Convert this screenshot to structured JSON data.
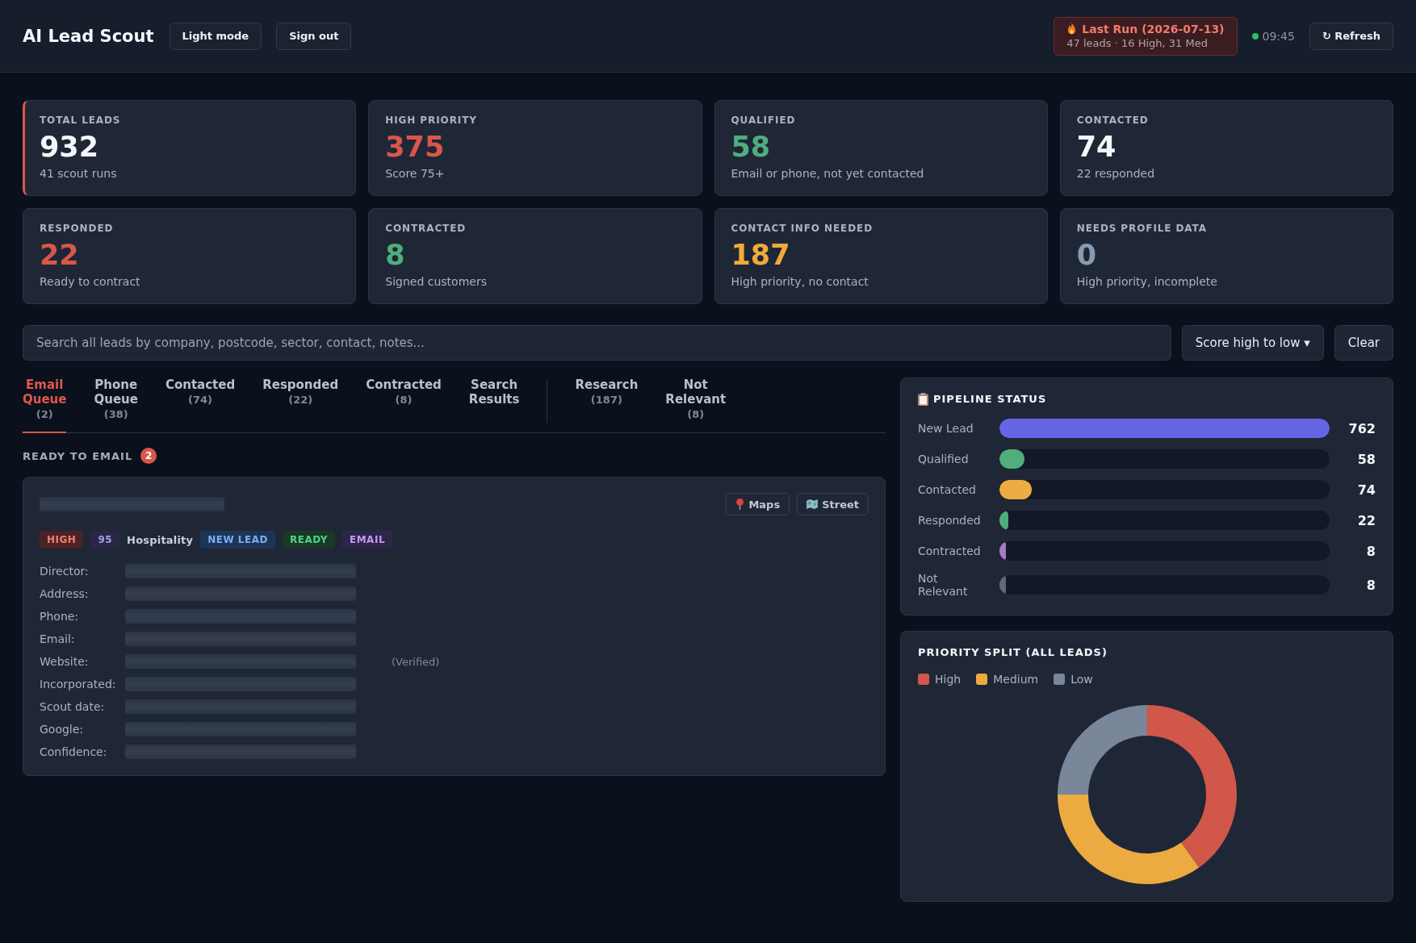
{
  "header": {
    "title": "AI Lead Scout",
    "buttons": [
      "Light mode",
      "Sign out"
    ],
    "last_run": {
      "title": "Last Run (2026-07-13)",
      "summary": "47 leads · 16 High, 31 Med"
    },
    "clock": {
      "time": "09:45",
      "live": true
    },
    "refresh": "↻ Refresh"
  },
  "stats": [
    {
      "label": "TOTAL LEADS",
      "value": "932",
      "sub": "41 scout runs",
      "color": "#f4f6fa",
      "accent": true
    },
    {
      "label": "HIGH PRIORITY",
      "value": "375",
      "sub": "Score 75+",
      "color": "#d9574a",
      "accent": false
    },
    {
      "label": "QUALIFIED",
      "value": "58",
      "sub": "Email or phone, not yet contacted",
      "color": "#4fae7c",
      "accent": false
    },
    {
      "label": "CONTACTED",
      "value": "74",
      "sub": "22 responded",
      "color": "#f4f6fa",
      "accent": false
    },
    {
      "label": "RESPONDED",
      "value": "22",
      "sub": "Ready to contract",
      "color": "#d9574a",
      "accent": false
    },
    {
      "label": "CONTRACTED",
      "value": "8",
      "sub": "Signed customers",
      "color": "#4fae7c",
      "accent": false
    },
    {
      "label": "CONTACT INFO NEEDED",
      "value": "187",
      "sub": "High priority, no contact",
      "color": "#f0aa3c",
      "accent": false
    },
    {
      "label": "NEEDS PROFILE DATA",
      "value": "0",
      "sub": "High priority, incomplete",
      "color": "#8a9ab0",
      "accent": false
    }
  ],
  "search": {
    "placeholder": "Search all leads by company, postcode, sector, contact, notes...",
    "sort": "Score high to low ▾",
    "clear": "Clear"
  },
  "tab_groups": [
    {
      "tabs": [
        {
          "label": "Email Queue",
          "count": "(2)",
          "selected": true
        },
        {
          "label": "Phone Queue",
          "count": "(38)",
          "selected": false
        },
        {
          "label": "Contacted",
          "count": "(74)",
          "selected": false
        },
        {
          "label": "Responded",
          "count": "(22)",
          "selected": false
        },
        {
          "label": "Contracted",
          "count": "(8)",
          "selected": false
        },
        {
          "label": "Search Results",
          "selected": false
        }
      ]
    },
    {
      "tabs": [
        {
          "label": "Research",
          "count": "(187)",
          "selected": false
        },
        {
          "label": "Not Relevant",
          "count": "(8)",
          "selected": false
        }
      ]
    }
  ],
  "queue": {
    "heading": "READY TO EMAIL",
    "count": "2",
    "leads": [
      {
        "buttons": [
          {
            "label": "Maps",
            "kind": "maps"
          },
          {
            "label": "Street",
            "kind": "street"
          }
        ],
        "tags": [
          {
            "text": "HIGH",
            "kind": "priority"
          },
          {
            "text": "95",
            "kind": "score"
          },
          {
            "text": "Hospitality",
            "kind": "sector"
          },
          {
            "text": "NEW LEAD",
            "kind": "stage"
          },
          {
            "text": "READY",
            "kind": "ready"
          },
          {
            "text": "EMAIL",
            "kind": "channel"
          }
        ],
        "fields": [
          {
            "label": "Director:"
          },
          {
            "label": "Address:"
          },
          {
            "label": "Phone:"
          },
          {
            "label": "Email:"
          },
          {
            "label": "Website:",
            "note": "(Verified)"
          },
          {
            "label": "Incorporated:"
          },
          {
            "label": "Scout date:"
          },
          {
            "label": "Google:"
          },
          {
            "label": "Confidence:"
          }
        ]
      }
    ]
  },
  "pipeline": {
    "title": "PIPELINE STATUS",
    "rows": [
      {
        "label": "New Lead",
        "value": "762",
        "level": 1,
        "color": "#6466e6"
      },
      {
        "label": "Qualified",
        "value": "58",
        "level": 0.075,
        "color": "#52ad7c"
      },
      {
        "label": "Contacted",
        "value": "74",
        "level": 0.097,
        "color": "#edad43"
      },
      {
        "label": "Responded",
        "value": "22",
        "level": 0.028,
        "color": "#52ad7c"
      },
      {
        "label": "Contracted",
        "value": "8",
        "level": 0.019,
        "color": "#a77cc4"
      },
      {
        "label": "Not Relevant",
        "value": "8",
        "level": 0.019,
        "color": "#5f6b78"
      }
    ]
  },
  "priority_split": {
    "chart_data": {
      "type": "donut",
      "title": "PRIORITY SPLIT (ALL LEADS)",
      "categories": [
        "High",
        "Medium",
        "Low"
      ],
      "values": [
        40.2,
        34.8,
        25
      ],
      "colors": [
        "#d0574a",
        "#ecab40",
        "#7a8699"
      ]
    }
  }
}
